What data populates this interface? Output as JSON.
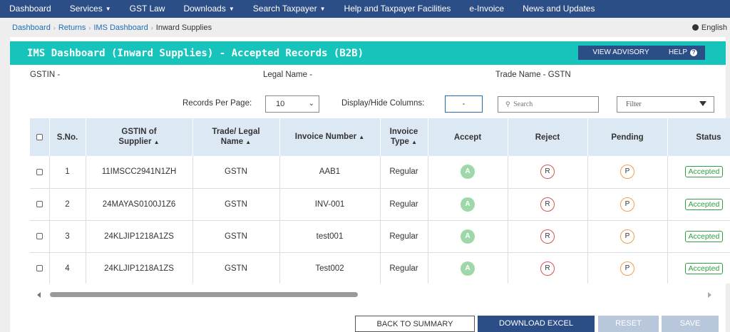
{
  "nav": [
    {
      "label": "Dashboard",
      "caret": false
    },
    {
      "label": "Services",
      "caret": true
    },
    {
      "label": "GST Law",
      "caret": false
    },
    {
      "label": "Downloads",
      "caret": true
    },
    {
      "label": "Search Taxpayer",
      "caret": true
    },
    {
      "label": "Help and Taxpayer Facilities",
      "caret": false
    },
    {
      "label": "e-Invoice",
      "caret": false
    },
    {
      "label": "News and Updates",
      "caret": false
    }
  ],
  "breadcrumb": {
    "items": [
      "Dashboard",
      "Returns",
      "IMS Dashboard"
    ],
    "current": "Inward Supplies",
    "language": "English"
  },
  "header": {
    "title": "IMS Dashboard (Inward Supplies) - Accepted Records (B2B)",
    "advisory_label": "VIEW ADVISORY",
    "help_label": "HELP",
    "help_icon": "?"
  },
  "info": {
    "gstin": "GSTIN -",
    "legal_name": "Legal Name -",
    "trade_name": "Trade Name - GSTN"
  },
  "controls": {
    "records_per_page_label": "Records Per Page:",
    "records_per_page_value": "10",
    "display_columns_label": "Display/Hide Columns:",
    "display_columns_value": "-",
    "search_placeholder": "Search",
    "filter_label": "Filter"
  },
  "table": {
    "headers": {
      "sno": "S.No.",
      "gstin_l1": "GSTIN of",
      "gstin_l2": "Supplier",
      "trade_l1": "Trade/ Legal",
      "trade_l2": "Name",
      "invoice_number": "Invoice Number",
      "invoice_type_l1": "Invoice",
      "invoice_type_l2": "Type",
      "accept": "Accept",
      "reject": "Reject",
      "pending": "Pending",
      "status": "Status"
    },
    "sort_glyph": "▲",
    "rows": [
      {
        "sno": "1",
        "gstin": "11IMSCC2941N1ZH",
        "name": "GSTN",
        "invoice": "AAB1",
        "type": "Regular",
        "accept": "A",
        "reject": "R",
        "pending": "P",
        "status": "Accepted"
      },
      {
        "sno": "2",
        "gstin": "24MAYAS0100J1Z6",
        "name": "GSTN",
        "invoice": "INV-001",
        "type": "Regular",
        "accept": "A",
        "reject": "R",
        "pending": "P",
        "status": "Accepted"
      },
      {
        "sno": "3",
        "gstin": "24KLJIP1218A1ZS",
        "name": "GSTN",
        "invoice": "test001",
        "type": "Regular",
        "accept": "A",
        "reject": "R",
        "pending": "P",
        "status": "Accepted"
      },
      {
        "sno": "4",
        "gstin": "24KLJIP1218A1ZS",
        "name": "GSTN",
        "invoice": "Test002",
        "type": "Regular",
        "accept": "A",
        "reject": "R",
        "pending": "P",
        "status": "Accepted"
      }
    ]
  },
  "buttons": {
    "back": "BACK TO SUMMARY",
    "download": "DOWNLOAD EXCEL",
    "reset": "RESET",
    "save": "SAVE"
  },
  "colors": {
    "nav": "#2c4e86",
    "header": "#17c4bb",
    "primary_button": "#2c4e86",
    "disabled_button": "#b8c7db",
    "accept": "#9ed8a8",
    "reject": "#d9534f",
    "pending": "#f0a04b",
    "status": "#2e9e3f"
  }
}
